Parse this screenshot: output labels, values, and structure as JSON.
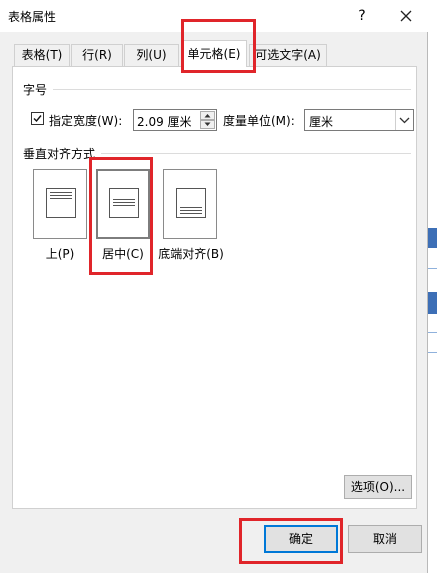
{
  "window": {
    "title": "表格属性",
    "help": "?",
    "close_icon": "close-icon"
  },
  "tabs": [
    {
      "label": "表格(T)"
    },
    {
      "label": "行(R)"
    },
    {
      "label": "列(U)"
    },
    {
      "label": "单元格(E)",
      "active": true
    },
    {
      "label": "可选文字(A)"
    }
  ],
  "size": {
    "section": "字号",
    "checkbox_checked": true,
    "specify_width": "指定宽度(W):",
    "width_value": "2.09 厘米",
    "unit_label": "度量单位(M):",
    "unit_value": "厘米"
  },
  "valign": {
    "section": "垂直对齐方式",
    "options": [
      {
        "label": "上(P)",
        "icon": "align-top-icon"
      },
      {
        "label": "居中(C)",
        "icon": "align-center-icon",
        "selected": true
      },
      {
        "label": "底端对齐(B)",
        "icon": "align-bottom-icon"
      }
    ]
  },
  "buttons": {
    "options": "选项(O)...",
    "ok": "确定",
    "cancel": "取消"
  },
  "colors": {
    "highlight": "#e0252a",
    "focus": "#0078d7"
  }
}
